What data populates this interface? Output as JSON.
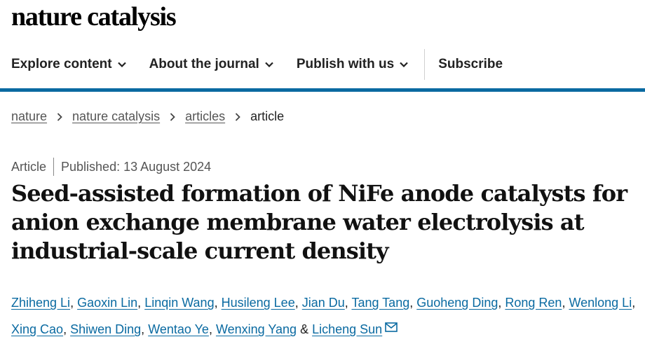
{
  "site": {
    "logo": "nature catalysis"
  },
  "nav": {
    "explore": "Explore content",
    "about": "About the journal",
    "publish": "Publish with us",
    "subscribe": "Subscribe"
  },
  "breadcrumb": {
    "items": [
      "nature",
      "nature catalysis",
      "articles"
    ],
    "current": "article"
  },
  "meta": {
    "type": "Article",
    "published": "Published: 13 August 2024"
  },
  "title": "Seed-assisted formation of NiFe anode catalysts for anion exchange membrane water electrolysis at industrial-scale current density",
  "authors": [
    "Zhiheng Li",
    "Gaoxin Lin",
    "Linqin Wang",
    "Husileng Lee",
    "Jian Du",
    "Tang Tang",
    "Guoheng Ding",
    "Rong Ren",
    "Wenlong Li",
    "Xing Cao",
    "Shiwen Ding",
    "Wentao Ye",
    "Wenxing Yang",
    "Licheng Sun"
  ],
  "author_separators": {
    "comma": ",",
    "and": "&"
  },
  "icons": {
    "dropdown": "chevron-down-icon",
    "breadcrumb": "chevron-right-icon",
    "contact": "mail-icon"
  },
  "colors": {
    "accent": "#0a6aa1",
    "text": "#222222",
    "muted": "#555555"
  }
}
